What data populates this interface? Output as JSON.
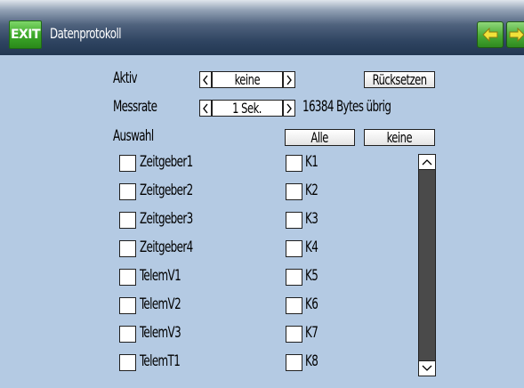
{
  "header": {
    "exit_label": "EXIT",
    "title": "Datenprotokoll",
    "prev_icon": "arrow-left-icon",
    "next_icon": "arrow-right-icon"
  },
  "settings": {
    "aktiv_label": "Aktiv",
    "aktiv_value": "keine",
    "reset_label": "Rücksetzen",
    "messrate_label": "Messrate",
    "messrate_value": "1 Sek.",
    "bytes_remaining": "16384 Bytes übrig",
    "auswahl_label": "Auswahl",
    "select_all_label": "Alle",
    "select_none_label": "keine"
  },
  "left_column": [
    "Zeitgeber1",
    "Zeitgeber2",
    "Zeitgeber3",
    "Zeitgeber4",
    "TelemV1",
    "TelemV2",
    "TelemV3",
    "TelemT1"
  ],
  "right_column": [
    "K1",
    "K2",
    "K3",
    "K4",
    "K5",
    "K6",
    "K7",
    "K8"
  ],
  "colors": {
    "background": "#b4cae3",
    "header_dark": "#2f4461",
    "accent_green": "#3ea92a"
  }
}
